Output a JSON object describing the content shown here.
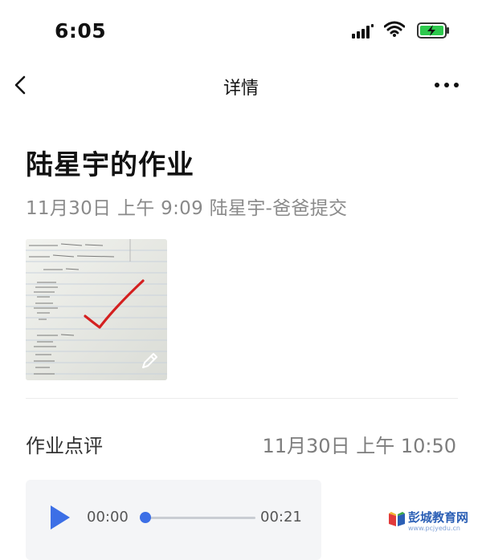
{
  "status_bar": {
    "time": "6:05",
    "icons": [
      "signal-icon",
      "wifi-icon",
      "battery-charging-icon"
    ]
  },
  "nav": {
    "title": "详情",
    "back_icon": "chevron-left-icon",
    "more_icon": "more-dots-icon"
  },
  "homework": {
    "title": "陆星宇的作业",
    "submit_info": "11月30日 上午 9:09  陆星宇-爸爸提交",
    "image": {
      "alt": "homework-photo",
      "mark": "red-check",
      "edit_icon": "pencil-icon"
    }
  },
  "review": {
    "label": "作业点评",
    "time": "11月30日 上午 10:50",
    "audio": {
      "current": "00:00",
      "total": "00:21",
      "progress": 0
    }
  },
  "watermark": {
    "name": "彭城教育网",
    "url": "www.pcjyedu.cn"
  },
  "colors": {
    "accent": "#3c6fe6",
    "check": "#d42020",
    "muted": "#8a8a8a"
  }
}
